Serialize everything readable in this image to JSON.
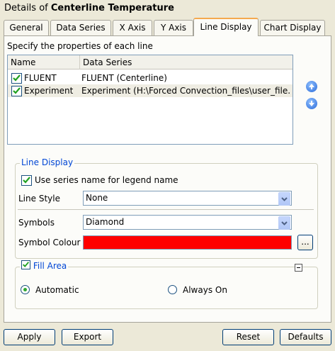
{
  "title": {
    "prefix": "Details of",
    "name": "Centerline Temperature"
  },
  "tabs": [
    {
      "label": "General",
      "active": false
    },
    {
      "label": "Data Series",
      "active": false
    },
    {
      "label": "X Axis",
      "active": false
    },
    {
      "label": "Y Axis",
      "active": false
    },
    {
      "label": "Line Display",
      "active": true
    },
    {
      "label": "Chart Display",
      "active": false
    }
  ],
  "lines": {
    "heading": "Specify the properties of each line",
    "columns": [
      "Name",
      "Data Series"
    ],
    "rows": [
      {
        "name": "FLUENT",
        "series": "FLUENT (Centerline)",
        "checked": true
      },
      {
        "name": "Experiment",
        "series": "Experiment (H:\\Forced Convection_files\\user_file...",
        "checked": true
      }
    ],
    "move_up_icon": "arrow-up-icon",
    "move_down_icon": "arrow-down-icon"
  },
  "line_display": {
    "title": "Line Display",
    "use_series_name_label": "Use series name for legend name",
    "use_series_name_checked": true,
    "line_style_label": "Line Style",
    "line_style_value": "None",
    "symbols_label": "Symbols",
    "symbols_value": "Diamond",
    "symbol_colour_label": "Symbol Colour",
    "symbol_colour_value": "#ff0000",
    "colour_browse_label": "..."
  },
  "fill_area": {
    "title": "Fill Area",
    "checked": true,
    "collapse_icon": "minus-box-icon",
    "options": [
      {
        "label": "Automatic",
        "selected": true
      },
      {
        "label": "Always On",
        "selected": false
      }
    ]
  },
  "buttons": {
    "apply": "Apply",
    "export": "Export",
    "reset": "Reset",
    "defaults": "Defaults"
  },
  "colors": {
    "accent_tab": "#f5a94e",
    "group_title": "#0046d5",
    "selected_row": "#efede3"
  }
}
